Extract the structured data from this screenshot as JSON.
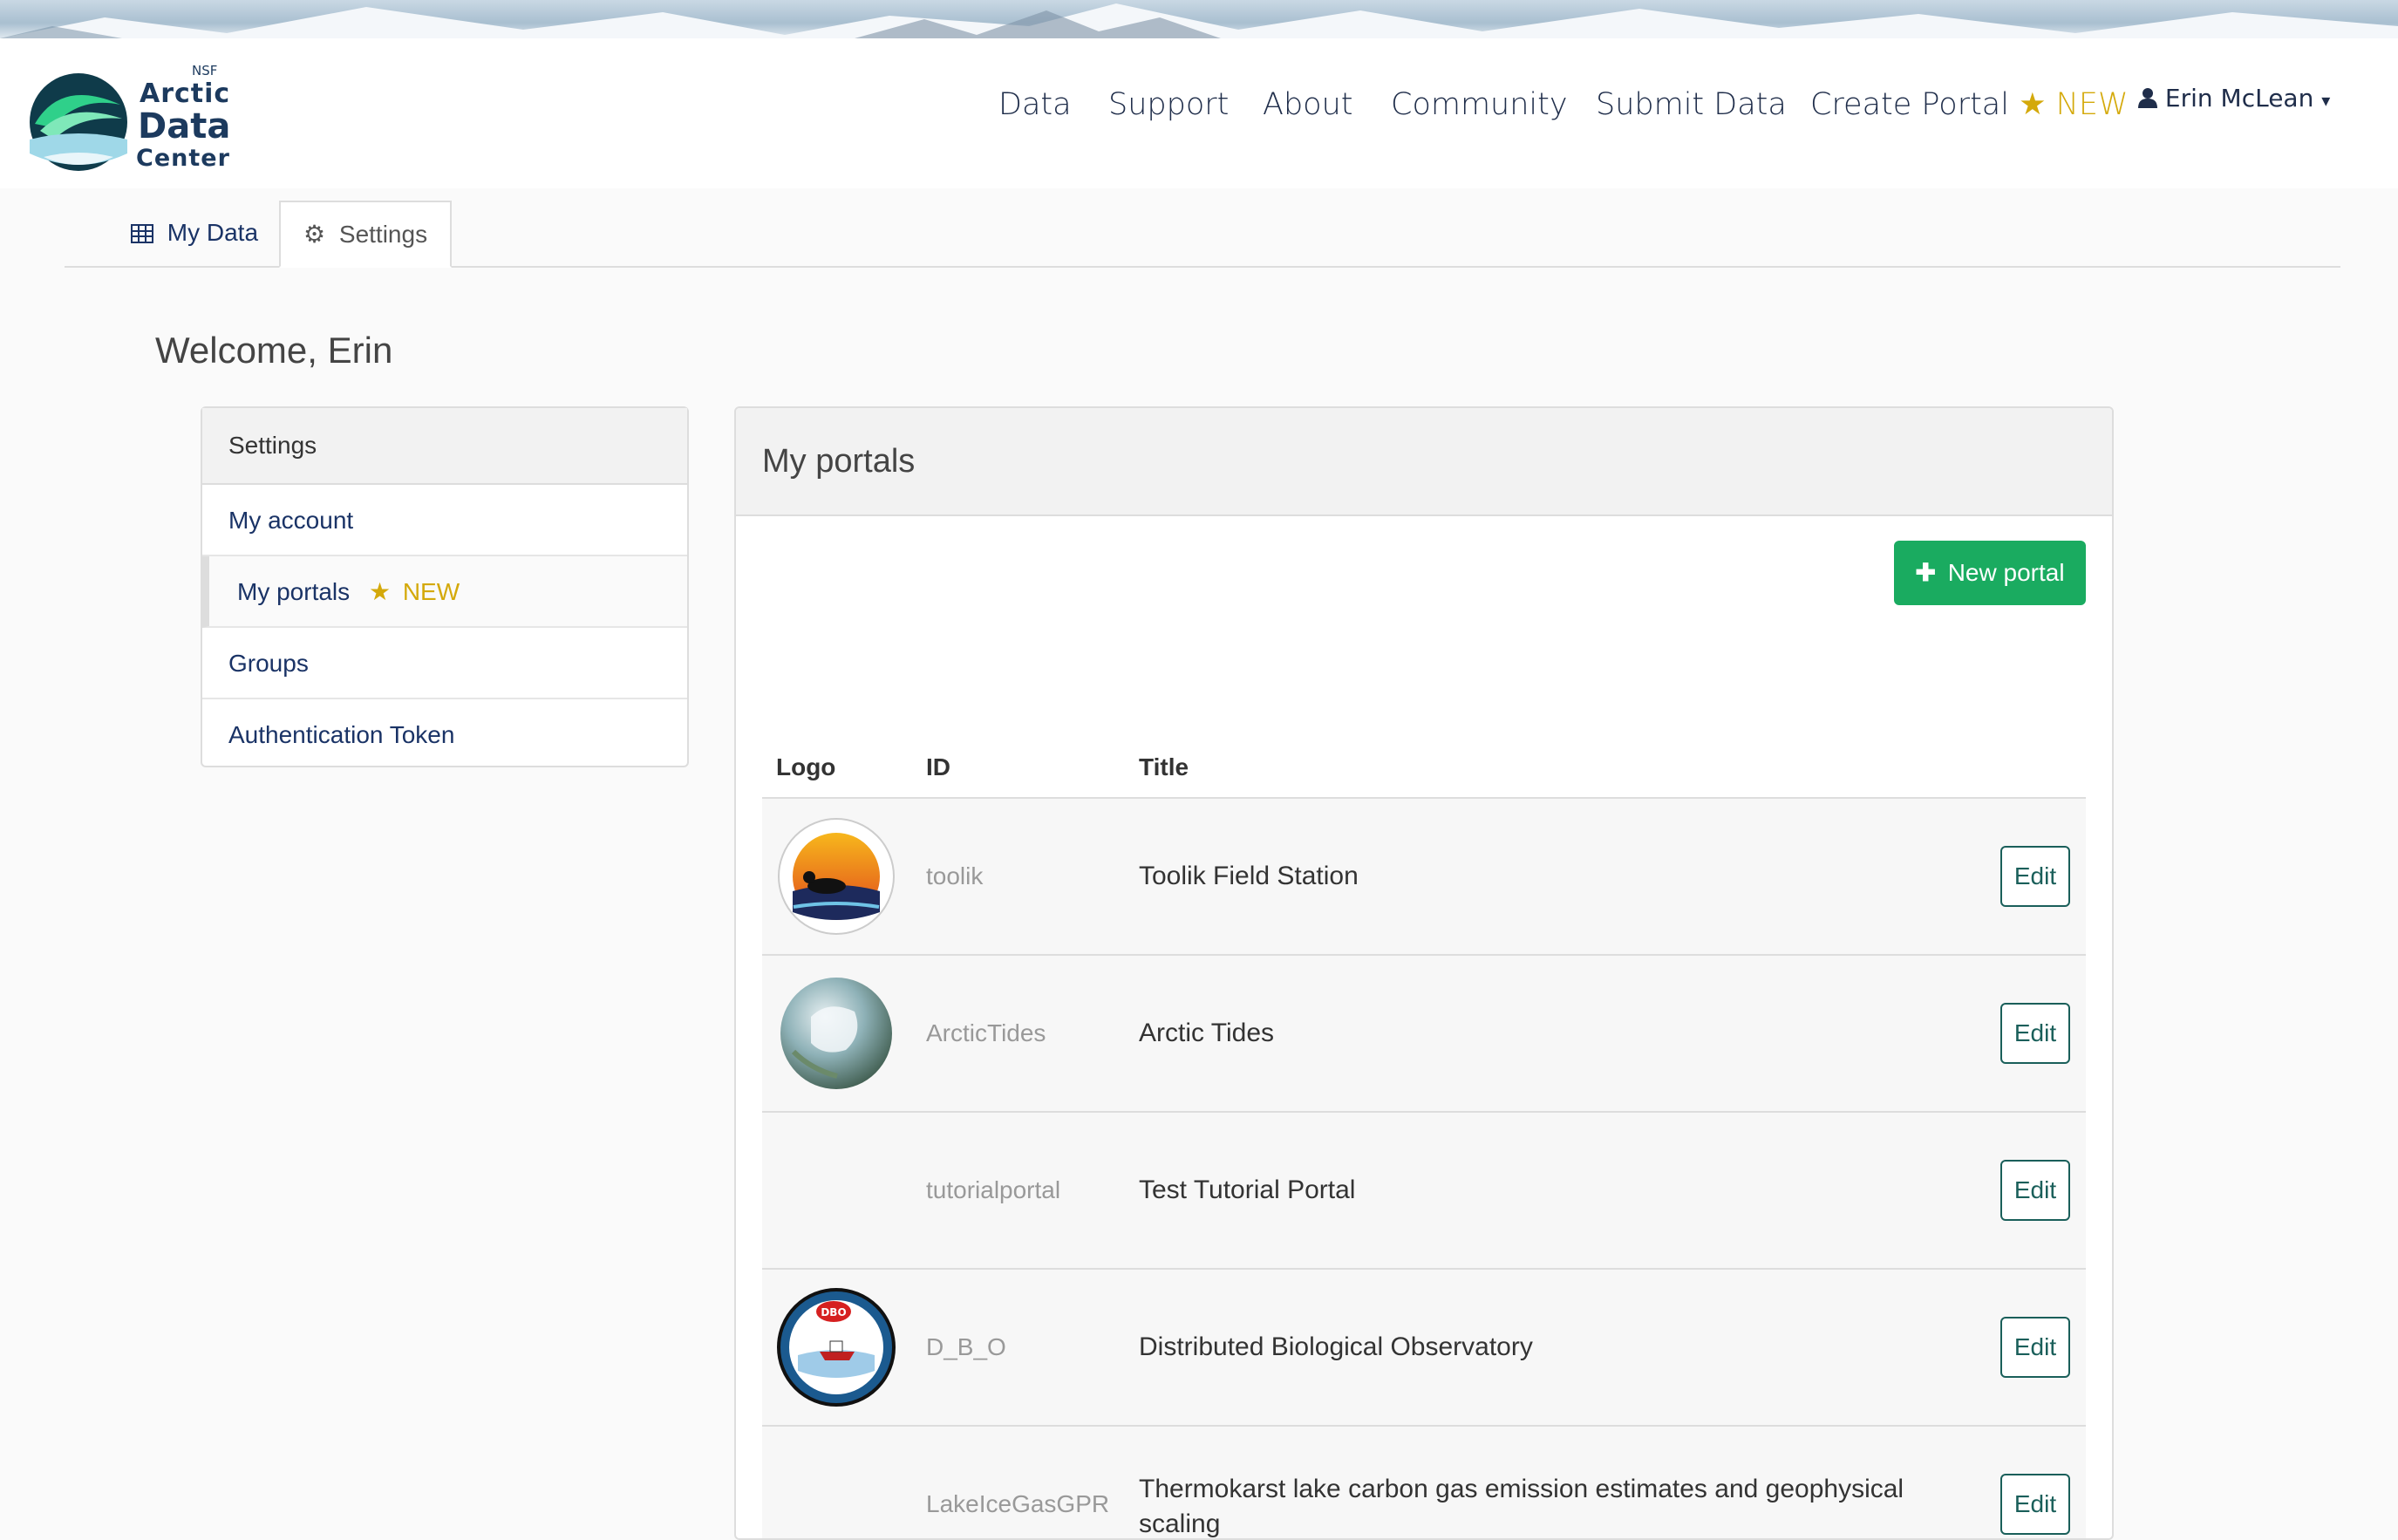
{
  "nav": {
    "logo": {
      "nsf": "NSF",
      "line1": "Arctic",
      "line2": "Data",
      "line3": "Center"
    },
    "links": [
      "Data",
      "Support",
      "About",
      "Community",
      "Submit Data"
    ],
    "create_portal": "Create Portal",
    "create_portal_badge": "NEW",
    "user_name": "Erin McLean"
  },
  "tabs": {
    "my_data": "My Data",
    "settings": "Settings"
  },
  "welcome": "Welcome, Erin",
  "settings_menu": {
    "heading": "Settings",
    "items": [
      "My account",
      "My portals",
      "Groups",
      "Authentication Token"
    ],
    "portals_badge": "NEW"
  },
  "portals": {
    "heading": "My portals",
    "new_portal_label": "New portal",
    "columns": [
      "Logo",
      "ID",
      "Title"
    ],
    "edit_label": "Edit",
    "rows": [
      {
        "id": "toolik",
        "title": "Toolik Field Station",
        "logo": "toolik-field-station-logo"
      },
      {
        "id": "ArcticTides",
        "title": "Arctic Tides",
        "logo": "arctic-globe-logo"
      },
      {
        "id": "tutorialportal",
        "title": "Test Tutorial Portal",
        "logo": ""
      },
      {
        "id": "D_B_O",
        "title": "Distributed Biological Observatory",
        "logo": "dbo-logo"
      },
      {
        "id": "LakeIceGasGPR",
        "title": "Thermokarst lake carbon gas emission estimates and geophysical scaling",
        "logo": ""
      }
    ]
  },
  "colors": {
    "accent_gold": "#d4a90a",
    "button_green": "#1aab60",
    "link_navy": "#1a3366",
    "edit_teal": "#1a5f5a"
  }
}
